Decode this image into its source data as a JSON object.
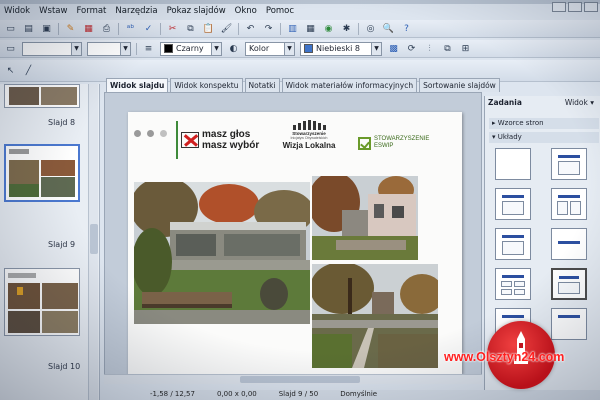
{
  "menu": {
    "items": [
      "Widok",
      "Wstaw",
      "Format",
      "Narzędzia",
      "Pokaz slajdów",
      "Okno",
      "Pomoc"
    ]
  },
  "toolbar": {
    "line_color": "Czarny",
    "area_style": "Kolor",
    "fill_color": "Niebieski 8",
    "fill_color_hex": "#3f74c9"
  },
  "tabs": [
    {
      "label": "Widok slajdu",
      "active": true
    },
    {
      "label": "Widok konspektu"
    },
    {
      "label": "Notatki"
    },
    {
      "label": "Widok materiałów informacyjnych"
    },
    {
      "label": "Sortowanie slajdów"
    }
  ],
  "slide_pane": {
    "slides": [
      {
        "label": "Slajd 8"
      },
      {
        "label": "Slajd 9",
        "selected": true
      },
      {
        "label": "Slajd 10"
      }
    ]
  },
  "slide": {
    "logo_left_line1": "masz głos",
    "logo_left_line2": "masz wybór",
    "logo_center_line1": "Stowarzyszenie",
    "logo_center_line2": "Inicjatyw Obywatelskich",
    "logo_center_line3": "Wizja Lokalna",
    "logo_right_line1": "STOWARZYSZENIE",
    "logo_right_line2": "ESWIP"
  },
  "task_pane": {
    "title": "Zadania",
    "view_label": "Widok",
    "section_masters": "Wzorce stron",
    "section_layouts": "Układy"
  },
  "status": {
    "position": "-1,58 / 12,57",
    "size": "0,00 x 0,00",
    "slide": "Slajd 9 / 50",
    "style": "Domyślnie"
  },
  "watermark": {
    "text": "www.Olsztyn24.com"
  },
  "colors": {
    "selection": "#4a78d0",
    "watermark_red": "#ff2020"
  }
}
